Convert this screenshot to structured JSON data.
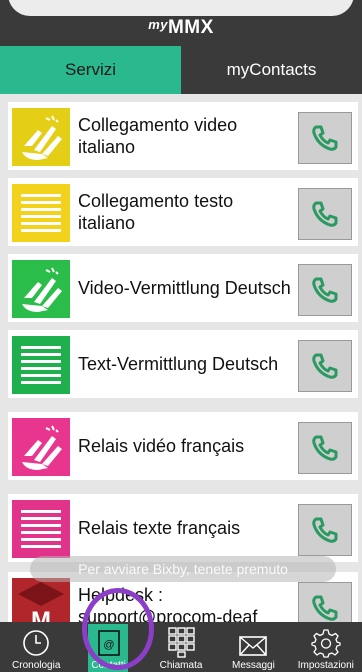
{
  "header": {
    "logo_prefix": "my",
    "logo_main": "MMX"
  },
  "tabs": [
    {
      "label": "Servizi",
      "active": true
    },
    {
      "label": "myContacts",
      "active": false
    }
  ],
  "services": [
    {
      "label": "Collegamento video italiano",
      "icon": "sign-language-hands-icon",
      "color": "#e5cf16"
    },
    {
      "label": "Collegamento testo italiano",
      "icon": "text-lines-icon",
      "color": "#f2d21a"
    },
    {
      "label": "Video-Vermittlung Deutsch",
      "icon": "sign-language-hands-icon",
      "color": "#2bbd4a"
    },
    {
      "label": "Text-Vermittlung Deutsch",
      "icon": "text-lines-icon",
      "color": "#1fb04e"
    },
    {
      "label": "Relais vidéo français",
      "icon": "sign-language-hands-icon",
      "color": "#e8368f"
    },
    {
      "label": "Relais texte français",
      "icon": "text-lines-icon",
      "color": "#e2338b"
    },
    {
      "label": "Helpdesk : support@procom-deaf",
      "icon": "mmx-logo-icon",
      "color": "#b1262a"
    }
  ],
  "toast": "Per avviare Bixby, tenete premuto",
  "colors": {
    "accent": "#2ab88f",
    "dark": "#3a3a3a",
    "call_icon": "#2a9a62",
    "highlight_ring": "#8b3ec7"
  },
  "bottom_nav": [
    {
      "label": "Cronologia",
      "icon": "clock-icon"
    },
    {
      "label": "Contatti",
      "icon": "contacts-book-icon",
      "active": true
    },
    {
      "label": "Chiamata",
      "icon": "keypad-icon"
    },
    {
      "label": "Messaggi",
      "icon": "envelope-icon"
    },
    {
      "label": "Impostazioni",
      "icon": "gear-icon"
    }
  ]
}
